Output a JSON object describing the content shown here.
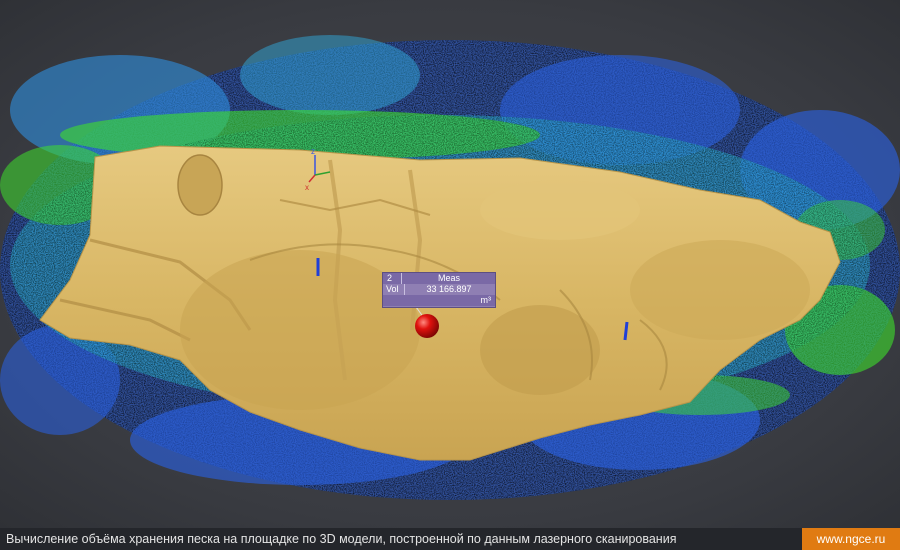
{
  "measurement": {
    "id": "2",
    "header": "Meas",
    "label": "Vol",
    "value": "33 166.897",
    "unit": "m³"
  },
  "caption": {
    "text": "Вычисление объёма хранения песка на площадке по 3D модели, построенной по данным лазерного сканирования",
    "site": "www.ngce.ru"
  },
  "axes": {
    "x_label": "x",
    "z_label": "z"
  },
  "colors": {
    "background": "#3d4047",
    "sand_surface": "#d9b867",
    "scan_blue": "#2a63e8",
    "scan_cyan": "#2fb7d9",
    "scan_green": "#3ee02b",
    "marker_red": "#e0120e",
    "caption_badge": "#e07b12"
  }
}
